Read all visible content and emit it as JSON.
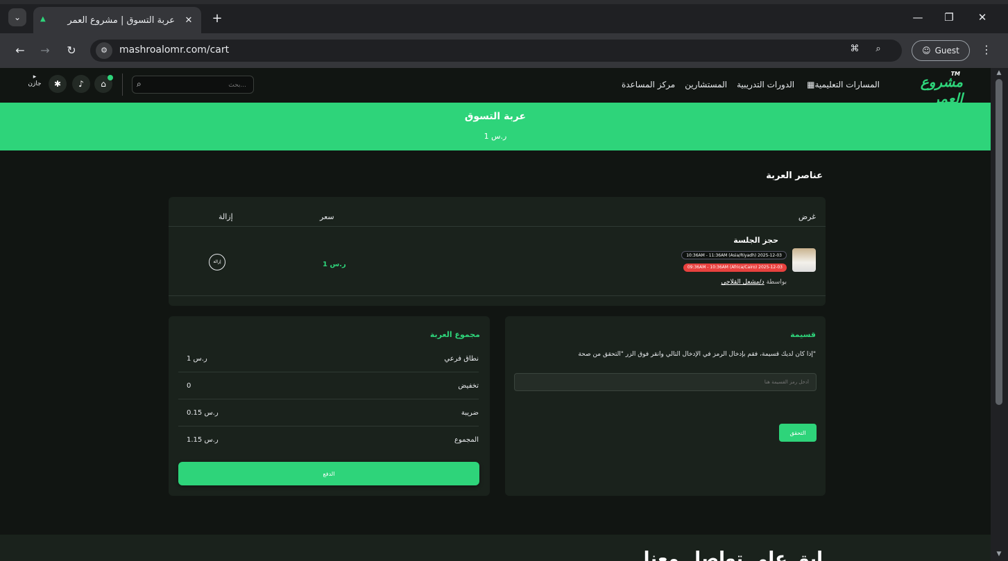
{
  "browser": {
    "tab_title": "عربة التسوق | مشروع العمر",
    "url": "mashroalomr.com/cart",
    "profile": "Guest"
  },
  "header": {
    "logo": "مشروع العمر",
    "logo_tm": "TM",
    "nav": [
      "المسارات التعليمية",
      "الدورات التدريبية",
      "المستشارين",
      "مركز المساعدة"
    ],
    "search_placeholder": "بحث...",
    "lang_label": "جازن"
  },
  "banner": {
    "title": "عربة التسوق",
    "subtitle": "1 ر.س"
  },
  "cart": {
    "section_title": "عناصر العربة",
    "columns": {
      "offer": "غرض",
      "price": "سعر",
      "remove": "إزالة"
    },
    "item": {
      "name": "حجز الجلسة",
      "time_riyadh": "10:36AM - 11:36AM (Asia/Riyadh) 2025-12-03",
      "time_cairo": "09:36AM - 10:36AM (Africa/Cairo) 2025-12-03",
      "by_label": "بواسطة",
      "instructor": "د/مشعل القلاجي",
      "price": "1 ر.س",
      "remove_label": "إزالة"
    }
  },
  "totals": {
    "title": "مجموع العربة",
    "rows": [
      {
        "label": "نطاق فرعي",
        "value": "1 ر.س"
      },
      {
        "label": "تخفيض",
        "value": "0"
      },
      {
        "label": "ضريبة",
        "value": "0.15 ر.س"
      },
      {
        "label": "المجموع",
        "value": "1.15 ر.س"
      }
    ],
    "pay_label": "الدفع"
  },
  "coupon": {
    "title": "قسيمة",
    "description": "إذا كان لديك قسيمة، فقم بإدخال الرمز في الإدخال التالي وانقر فوق الزر \"التحقق من صحة\"",
    "placeholder": "أدخل رمز القسيمة هنا",
    "verify_label": "التحقق"
  },
  "footer": {
    "title": "ابق على تواصل معنا"
  },
  "colors": {
    "accent": "#2ed47a",
    "background": "#111512",
    "card": "#1a221c",
    "danger": "#e8413e"
  }
}
